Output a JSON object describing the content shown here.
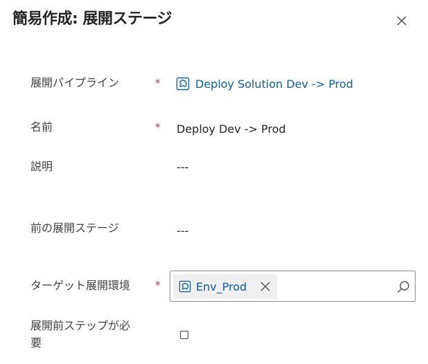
{
  "dialog": {
    "title": "簡易作成: 展開ステージ",
    "close_icon": "close-icon"
  },
  "fields": {
    "pipeline": {
      "label": "展開パイプライン",
      "required_mark": "*",
      "value": "Deploy Solution Dev -> Prod",
      "icon": "entity-puzzle-icon"
    },
    "name": {
      "label": "名前",
      "required_mark": "*",
      "value": "Deploy Dev -> Prod"
    },
    "description": {
      "label": "説明",
      "value": "---"
    },
    "previous_stage": {
      "label": "前の展開ステージ",
      "value": "---"
    },
    "target_environment": {
      "label": "ターゲット展開環境",
      "required_mark": "*",
      "tag_value": "Env_Prod",
      "tag_icon": "entity-puzzle-icon",
      "remove_icon": "close-icon",
      "search_icon": "search-icon"
    },
    "predeployment_step": {
      "label_line1": "展開前ステップが必",
      "label_line2": "要",
      "checked": false
    }
  },
  "colors": {
    "link": "#115ea3",
    "required": "#c4314b",
    "text": "#242424",
    "label": "#424242"
  }
}
